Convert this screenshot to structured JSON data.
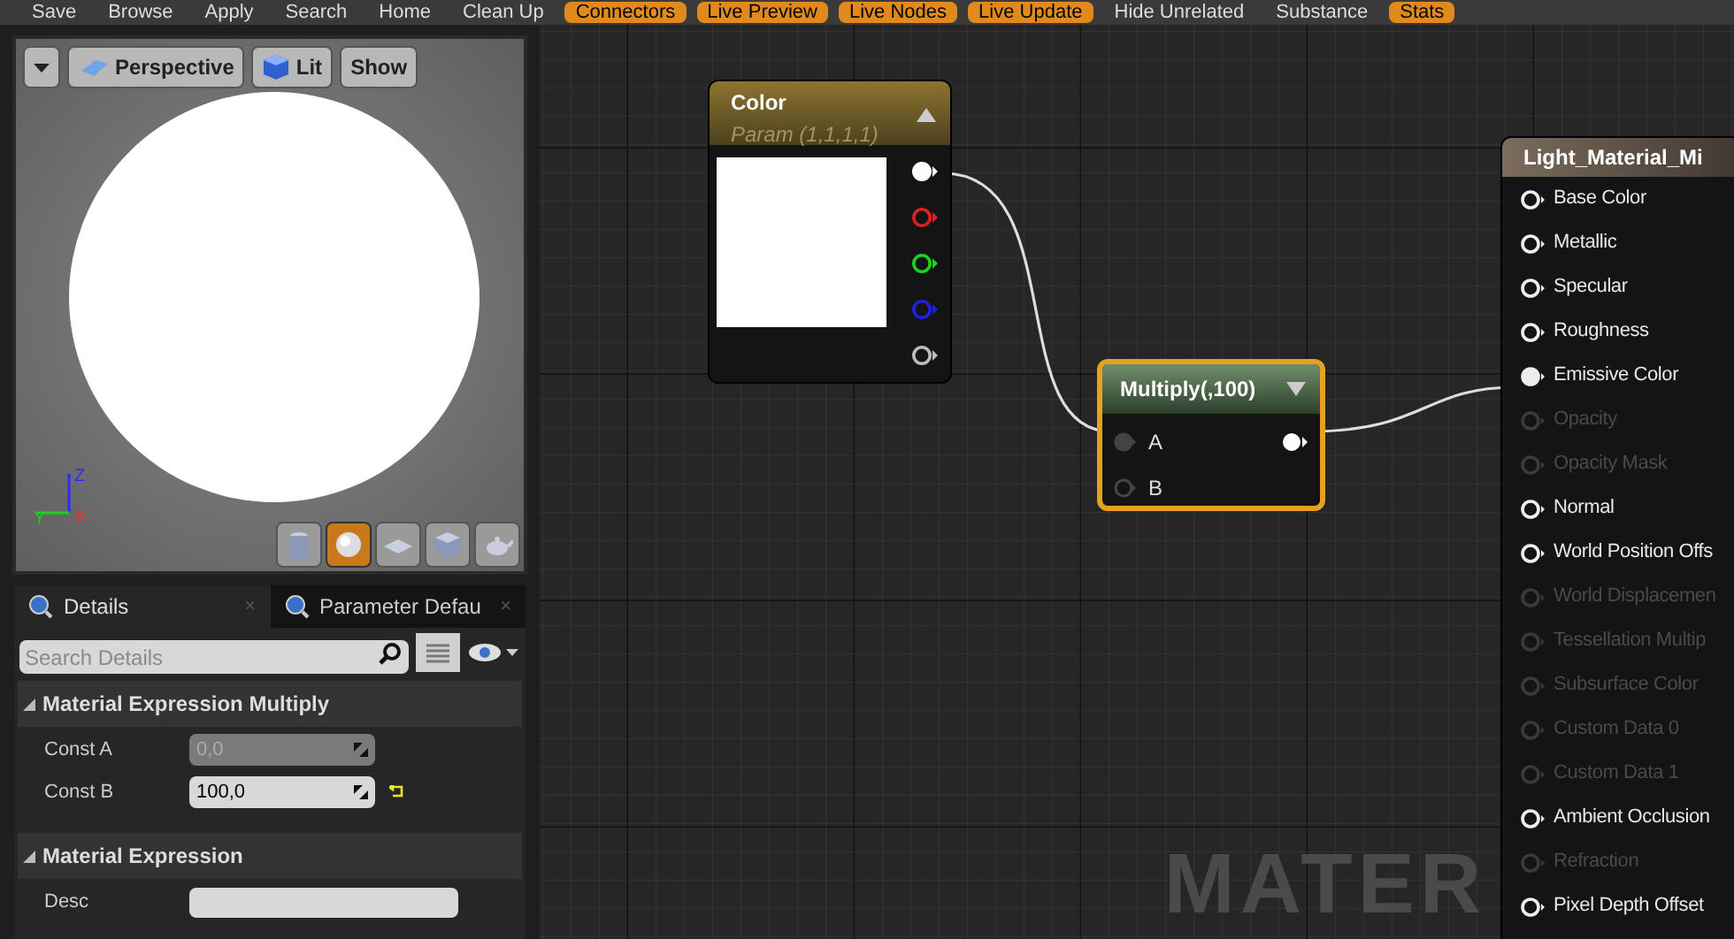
{
  "toolbar": [
    {
      "label": "Save",
      "active": false
    },
    {
      "label": "Browse",
      "active": false
    },
    {
      "label": "Apply",
      "active": false
    },
    {
      "label": "Search",
      "active": false
    },
    {
      "label": "Home",
      "active": false
    },
    {
      "label": "Clean Up",
      "active": false
    },
    {
      "label": "Connectors",
      "active": true
    },
    {
      "label": "Live Preview",
      "active": true
    },
    {
      "label": "Live Nodes",
      "active": true
    },
    {
      "label": "Live Update",
      "active": true
    },
    {
      "label": "Hide Unrelated",
      "active": false
    },
    {
      "label": "Substance",
      "active": false
    },
    {
      "label": "Stats",
      "active": true
    }
  ],
  "viewport": {
    "buttons": [
      {
        "kind": "menu"
      },
      {
        "kind": "perspective",
        "label": "Perspective"
      },
      {
        "kind": "lit",
        "label": "Lit"
      },
      {
        "kind": "text",
        "label": "Show"
      }
    ],
    "axis": {
      "z": "Z",
      "y": "Y",
      "x": "X"
    },
    "shapes": [
      {
        "kind": "cylinder",
        "selected": false
      },
      {
        "kind": "sphere",
        "selected": true
      },
      {
        "kind": "plane",
        "selected": false
      },
      {
        "kind": "cube",
        "selected": false
      },
      {
        "kind": "teapot",
        "selected": false
      }
    ]
  },
  "details": {
    "tabs": [
      {
        "label": "Details",
        "selected": true,
        "close_icon": "×"
      },
      {
        "label": "Parameter Defau",
        "selected": false,
        "close_icon": "×"
      }
    ],
    "search": {
      "placeholder": "Search Details"
    },
    "sections": [
      {
        "title": "Material Expression Multiply",
        "properties": [
          {
            "label": "Const A",
            "value": "0,0",
            "disabled": true,
            "modified": false
          },
          {
            "label": "Const B",
            "value": "100,0",
            "disabled": false,
            "modified": true
          }
        ]
      },
      {
        "title": "Material Expression",
        "properties": [
          {
            "label": "Desc",
            "disabled": false,
            "modified": false
          }
        ]
      }
    ]
  },
  "graph": {
    "color_node": {
      "title": "Color",
      "subtitle": "Param (1,1,1,1)",
      "pins": [
        {
          "color": "#ffffff",
          "connected": true
        },
        {
          "color": "#e02020",
          "connected": false
        },
        {
          "color": "#20d020",
          "connected": false
        },
        {
          "color": "#2020e0",
          "connected": false
        },
        {
          "color": "#bbbbbb",
          "connected": false
        }
      ]
    },
    "multiply_node": {
      "title": "Multiply(,100)",
      "selected": true,
      "inputs": [
        {
          "label": "A",
          "connected": true
        },
        {
          "label": "B",
          "connected": false
        }
      ]
    },
    "material_node": {
      "title": "Light_Material_Mi",
      "inputs": [
        {
          "label": "Base Color",
          "enabled": true,
          "connected": false
        },
        {
          "label": "Metallic",
          "enabled": true,
          "connected": false
        },
        {
          "label": "Specular",
          "enabled": true,
          "connected": false
        },
        {
          "label": "Roughness",
          "enabled": true,
          "connected": false
        },
        {
          "label": "Emissive Color",
          "enabled": true,
          "connected": true
        },
        {
          "label": "Opacity",
          "enabled": false,
          "connected": false
        },
        {
          "label": "Opacity Mask",
          "enabled": false,
          "connected": false
        },
        {
          "label": "Normal",
          "enabled": true,
          "connected": false
        },
        {
          "label": "World Position Offs",
          "enabled": true,
          "connected": false
        },
        {
          "label": "World Displacemen",
          "enabled": false,
          "connected": false
        },
        {
          "label": "Tessellation Multip",
          "enabled": false,
          "connected": false
        },
        {
          "label": "Subsurface Color",
          "enabled": false,
          "connected": false
        },
        {
          "label": "Custom Data 0",
          "enabled": false,
          "connected": false
        },
        {
          "label": "Custom Data 1",
          "enabled": false,
          "connected": false
        },
        {
          "label": "Ambient Occlusion",
          "enabled": true,
          "connected": false
        },
        {
          "label": "Refraction",
          "enabled": false,
          "connected": false
        },
        {
          "label": "Pixel Depth Offset",
          "enabled": true,
          "connected": false
        }
      ]
    },
    "background_label": "MATER"
  }
}
